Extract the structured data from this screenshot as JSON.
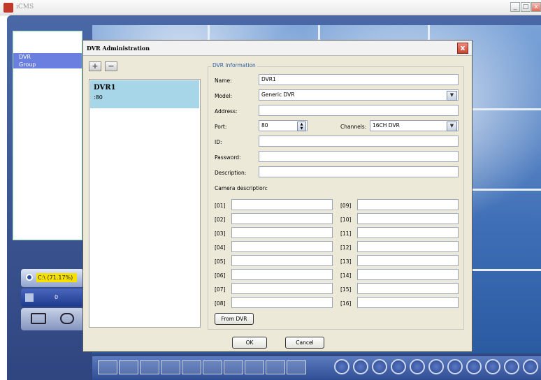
{
  "app": {
    "title": "iCMS"
  },
  "window_controls": {
    "minimize": "_",
    "maximize": "□",
    "close": "x"
  },
  "left_panel": {
    "tree": [
      "DVR",
      "Group"
    ]
  },
  "status": {
    "disk": "C:\\ (71.17%)",
    "count": "0"
  },
  "dialog": {
    "title": "DVR Administration",
    "close": "x",
    "toolbar": {
      "add": "+",
      "remove": "−"
    },
    "list": [
      {
        "name": "DVR1",
        "port": ":80"
      }
    ],
    "group_title": "DVR Information",
    "labels": {
      "name": "Name:",
      "model": "Model:",
      "address": "Address:",
      "port": "Port:",
      "channels": "Channels:",
      "id": "ID:",
      "password": "Password:",
      "description": "Description:",
      "camera_description": "Camera description:"
    },
    "values": {
      "name": "DVR1",
      "model": "Generic DVR",
      "address": "",
      "port": "80",
      "channels": "16CH DVR",
      "id": "",
      "password": "",
      "description": ""
    },
    "cameras": [
      "[01]",
      "[02]",
      "[03]",
      "[04]",
      "[05]",
      "[06]",
      "[07]",
      "[08]",
      "[09]",
      "[10]",
      "[11]",
      "[12]",
      "[13]",
      "[14]",
      "[15]",
      "[16]"
    ],
    "buttons": {
      "from_dvr": "From DVR",
      "ok": "OK",
      "cancel": "Cancel"
    }
  }
}
